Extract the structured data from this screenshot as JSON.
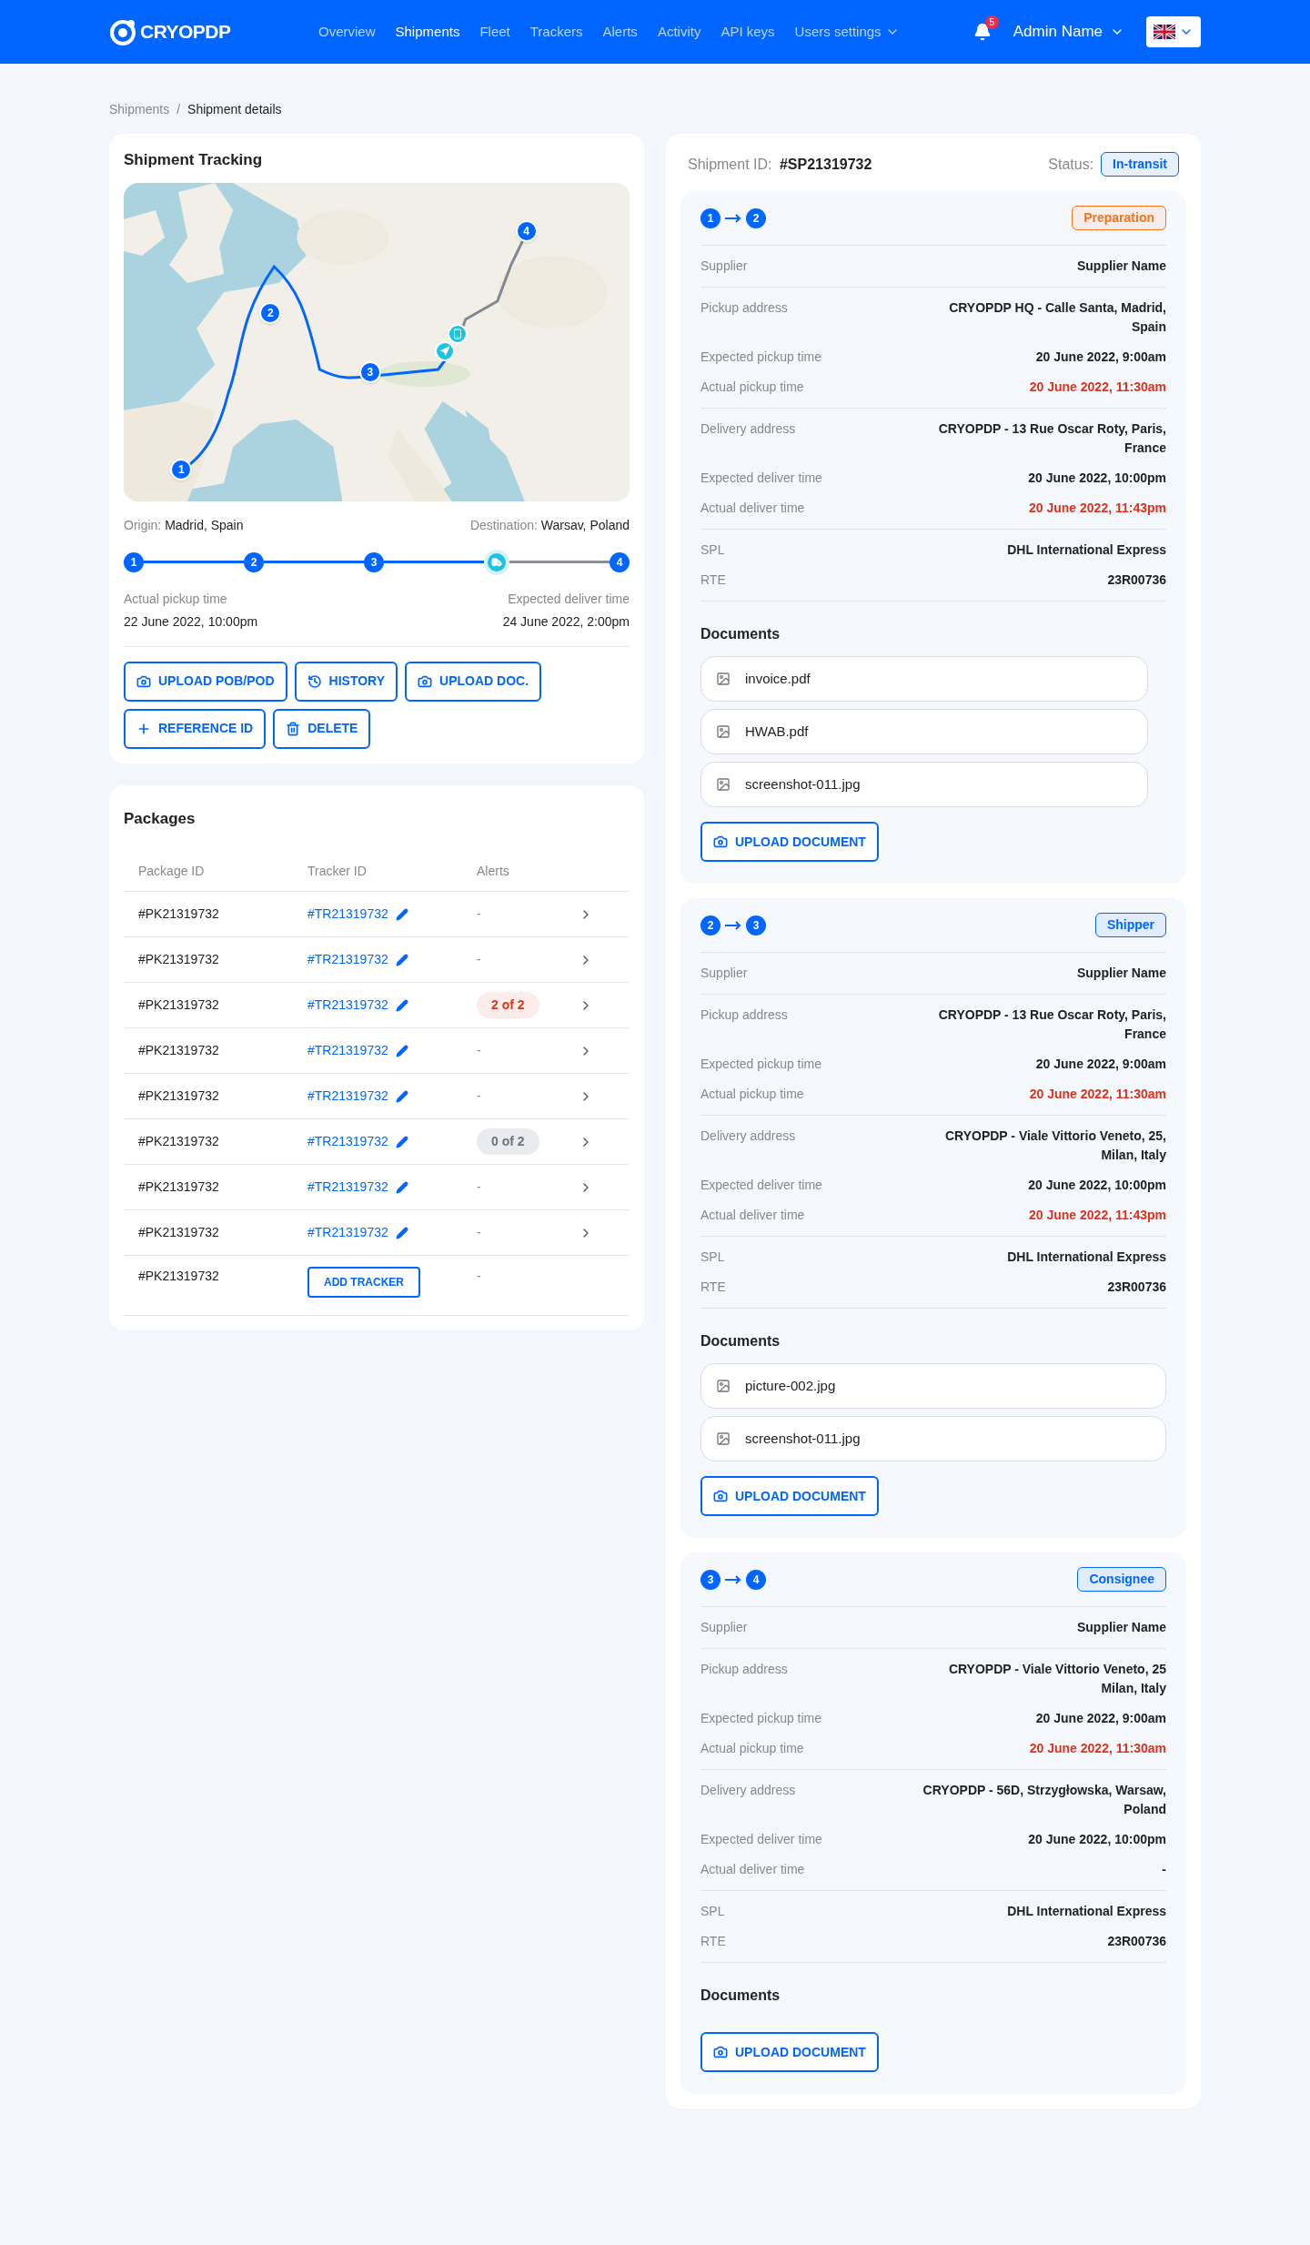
{
  "header": {
    "logo": "CRYOPDP",
    "nav": [
      {
        "label": "Overview",
        "selected": false
      },
      {
        "label": "Shipments",
        "selected": true
      },
      {
        "label": "Fleet",
        "selected": false
      },
      {
        "label": "Trackers",
        "selected": false
      },
      {
        "label": "Alerts",
        "selected": false
      },
      {
        "label": "Activity",
        "selected": false
      },
      {
        "label": "API keys",
        "selected": false
      },
      {
        "label": "Users settings",
        "selected": false,
        "dropdown": true
      }
    ],
    "notifications": "5",
    "user": "Admin Name"
  },
  "breadcrumb": [
    {
      "label": "Shipments",
      "selected": false
    },
    {
      "label": "Shipment details",
      "selected": true
    }
  ],
  "breadcrumb_separator": "/",
  "tracking": {
    "title": "Shipment Tracking",
    "map": {
      "kind": "picture",
      "markers": [
        "1",
        "2",
        "3",
        "4"
      ]
    },
    "origin_label": "Origin:",
    "origin": "Madrid, Spain",
    "destination_label": "Destination:",
    "destination": "Warsav, Poland",
    "steps": [
      {
        "kind": "stop",
        "label": "1"
      },
      {
        "kind": "stop",
        "label": "2"
      },
      {
        "kind": "stop",
        "label": "3"
      },
      {
        "kind": "vehicle"
      },
      {
        "kind": "stop",
        "label": "4"
      }
    ],
    "segments": [
      {
        "done": true
      },
      {
        "done": true
      },
      {
        "done": true
      },
      {
        "done": false
      }
    ],
    "pickup_label": "Actual pickup time",
    "pickup": "22 June 2022, 10:00pm",
    "deliver_label": "Expected deliver time",
    "deliver": "24 June 2022, 2:00pm",
    "buttons": [
      {
        "kind": "camera",
        "label": "UPLOAD POB/POD"
      },
      {
        "kind": "history",
        "label": "HISTORY"
      },
      {
        "kind": "camera",
        "label": "UPLOAD DOC."
      },
      {
        "kind": "plus",
        "label": "REFERENCE ID"
      },
      {
        "kind": "trash",
        "label": "DELETE"
      }
    ]
  },
  "packages": {
    "title": "Packages",
    "columns": [
      "Package ID",
      "Tracker ID",
      "Alerts"
    ],
    "rows": [
      {
        "package": "#PK21319732",
        "tracker": "#TR21319732",
        "alert": {
          "text": "-",
          "kind": "none"
        }
      },
      {
        "package": "#PK21319732",
        "tracker": "#TR21319732",
        "alert": {
          "text": "-",
          "kind": "none"
        }
      },
      {
        "package": "#PK21319732",
        "tracker": "#TR21319732",
        "alert": {
          "text": "2 of 2",
          "kind": "danger"
        }
      },
      {
        "package": "#PK21319732",
        "tracker": "#TR21319732",
        "alert": {
          "text": "-",
          "kind": "none"
        }
      },
      {
        "package": "#PK21319732",
        "tracker": "#TR21319732",
        "alert": {
          "text": "-",
          "kind": "none"
        }
      },
      {
        "package": "#PK21319732",
        "tracker": "#TR21319732",
        "alert": {
          "text": "0 of 2",
          "kind": "neutral"
        }
      },
      {
        "package": "#PK21319732",
        "tracker": "#TR21319732",
        "alert": {
          "text": "-",
          "kind": "none"
        }
      },
      {
        "package": "#PK21319732",
        "tracker": "#TR21319732",
        "alert": {
          "text": "-",
          "kind": "none"
        }
      },
      {
        "package": "#PK21319732",
        "add_tracker": "ADD TRACKER",
        "alert": {
          "text": "-",
          "kind": "none"
        }
      }
    ]
  },
  "shipment": {
    "id_label": "Shipment ID:",
    "id": "#SP21319732",
    "status_label": "Status:",
    "status": "In-transit",
    "legs": [
      {
        "from": "1",
        "to": "2",
        "badge": {
          "label": "Preparation",
          "color": "#f97316"
        },
        "groups": [
          [
            {
              "label": "Supplier",
              "value": "Supplier Name",
              "late": false
            }
          ],
          [
            {
              "label": "Pickup address",
              "value": "CRYOPDP HQ - Calle Santa, Madrid, Spain",
              "late": false
            },
            {
              "label": "Expected pickup time",
              "value": "20 June 2022, 9:00am",
              "late": false
            },
            {
              "label": "Actual pickup time",
              "value": "20 June 2022, 11:30am",
              "late": true
            }
          ],
          [
            {
              "label": "Delivery address",
              "value": "CRYOPDP - 13 Rue Oscar Roty, Paris, France",
              "late": false
            },
            {
              "label": "Expected deliver time",
              "value": "20 June 2022, 10:00pm",
              "late": false
            },
            {
              "label": "Actual deliver time",
              "value": "20 June 2022, 11:43pm",
              "late": true
            }
          ],
          [
            {
              "label": "SPL",
              "value": "DHL International Express",
              "late": false
            },
            {
              "label": "RTE",
              "value": "23R00736",
              "late": false
            }
          ]
        ],
        "documents_title": "Documents",
        "documents": [
          "invoice.pdf",
          "HWAB.pdf",
          "screenshot-011.jpg"
        ],
        "upload": "UPLOAD DOCUMENT"
      },
      {
        "from": "2",
        "to": "3",
        "badge": {
          "label": "Shipper",
          "color": "#0066ff"
        },
        "groups": [
          [
            {
              "label": "Supplier",
              "value": "Supplier Name",
              "late": false
            }
          ],
          [
            {
              "label": "Pickup address",
              "value": "CRYOPDP - 13 Rue Oscar Roty, Paris, France",
              "late": false
            },
            {
              "label": "Expected pickup time",
              "value": "20 June 2022, 9:00am",
              "late": false
            },
            {
              "label": "Actual pickup time",
              "value": "20 June 2022, 11:30am",
              "late": true
            }
          ],
          [
            {
              "label": "Delivery address",
              "value": "CRYOPDP - Viale Vittorio Veneto, 25, Milan, Italy",
              "late": false
            },
            {
              "label": "Expected deliver time",
              "value": "20 June 2022, 10:00pm",
              "late": false
            },
            {
              "label": "Actual deliver time",
              "value": "20 June 2022, 11:43pm",
              "late": true
            }
          ],
          [
            {
              "label": "SPL",
              "value": "DHL International Express",
              "late": false
            },
            {
              "label": "RTE",
              "value": "23R00736",
              "late": false
            }
          ]
        ],
        "documents_title": "Documents",
        "documents": [
          "picture-002.jpg",
          "screenshot-011.jpg"
        ],
        "upload": "UPLOAD DOCUMENT"
      },
      {
        "from": "3",
        "to": "4",
        "badge": {
          "label": "Consignee",
          "color": "#0066ff"
        },
        "groups": [
          [
            {
              "label": "Supplier",
              "value": "Supplier Name",
              "late": false
            }
          ],
          [
            {
              "label": "Pickup address",
              "value": "CRYOPDP - Viale Vittorio Veneto, 25 Milan, Italy",
              "late": false
            },
            {
              "label": "Expected pickup time",
              "value": "20 June 2022, 9:00am",
              "late": false
            },
            {
              "label": "Actual pickup time",
              "value": "20 June 2022, 11:30am",
              "late": true
            }
          ],
          [
            {
              "label": "Delivery address",
              "value": "CRYOPDP - 56D, Strzygłowska, Warsaw, Poland",
              "late": false
            },
            {
              "label": "Expected deliver time",
              "value": "20 June 2022, 10:00pm",
              "late": false
            },
            {
              "label": "Actual deliver time",
              "value": "-",
              "late": false
            }
          ],
          [
            {
              "label": "SPL",
              "value": "DHL International Express",
              "late": false
            },
            {
              "label": "RTE",
              "value": "23R00736",
              "late": false
            }
          ]
        ],
        "documents_title": "Documents",
        "upload": "UPLOAD DOCUMENT"
      }
    ]
  }
}
